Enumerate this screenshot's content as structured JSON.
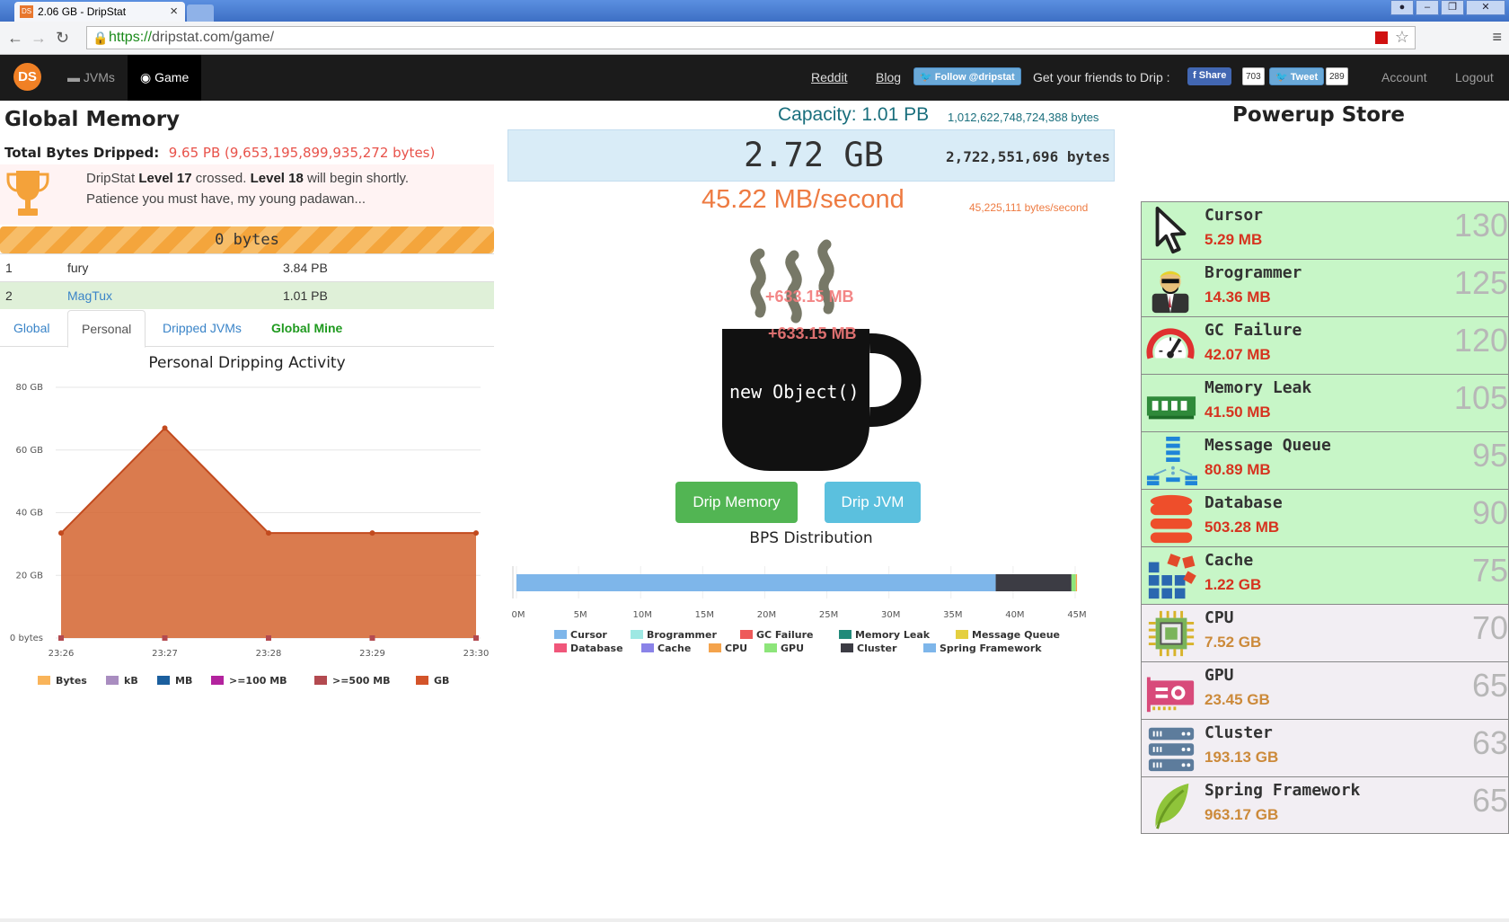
{
  "browser": {
    "tab_title": "2.06 GB - DripStat",
    "tab_favicon": "DS",
    "url_scheme": "https://",
    "url_rest": "dripstat.com/game/"
  },
  "nav": {
    "logo": "DS",
    "jvms": "JVMs",
    "game": "Game",
    "reddit": "Reddit",
    "blog": "Blog",
    "twitter_follow": "Follow @dripstat",
    "friends_text": "Get your friends to Drip :",
    "fb_share": "Share",
    "fb_count": "703",
    "tweet": "Tweet",
    "tweet_count": "289",
    "account": "Account",
    "logout": "Logout"
  },
  "global_memory": {
    "title": "Global Memory",
    "total_label": "Total Bytes Dripped:",
    "total_value": "9.65 PB (9,653,195,899,935,272 bytes)",
    "level_line1_a": "DripStat ",
    "level_line1_b": "Level 17",
    "level_line1_c": " crossed. ",
    "level_line1_d": "Level 18",
    "level_line1_e": " will begin shortly.",
    "level_line2": "Patience you must have, my young padawan...",
    "progress_label": "0 bytes",
    "progress_fraction": 0
  },
  "leaderboard": [
    {
      "rank": "1",
      "name": "fury",
      "value": "3.84 PB"
    },
    {
      "rank": "2",
      "name": "MagTux",
      "value": "1.01 PB"
    }
  ],
  "tabs": {
    "global": "Global",
    "personal": "Personal",
    "dripped": "Dripped JVMs",
    "mine": "Global Mine"
  },
  "activity_chart": {
    "title": "Personal Dripping Activity",
    "legend": [
      {
        "label": "Bytes",
        "color": "#f9b45a"
      },
      {
        "label": "kB",
        "color": "#a98dc0"
      },
      {
        "label": "MB",
        "color": "#1b5f9e"
      },
      {
        "label": ">=100 MB",
        "color": "#b3239e"
      },
      {
        "label": ">=500 MB",
        "color": "#b34a50"
      },
      {
        "label": "GB",
        "color": "#d3542a"
      }
    ]
  },
  "chart_data": [
    {
      "type": "area",
      "title": "Personal Dripping Activity",
      "x": [
        "23:26",
        "23:27",
        "23:28",
        "23:29",
        "23:30"
      ],
      "series": [
        {
          "name": "GB",
          "values": [
            33.5,
            67,
            33.5,
            33.5,
            33.5
          ]
        }
      ],
      "y_tick_labels": [
        "0 bytes",
        "20 GB",
        "40 GB",
        "60 GB",
        "80 GB"
      ],
      "y_ticks": [
        0,
        20,
        40,
        60,
        80
      ],
      "ylim": [
        0,
        80
      ],
      "grid": true,
      "legend_position": "bottom"
    },
    {
      "type": "bar",
      "title": "BPS Distribution",
      "orientation": "horizontal-stacked",
      "x_tick_labels": [
        "0M",
        "5M",
        "10M",
        "15M",
        "20M",
        "25M",
        "30M",
        "35M",
        "40M",
        "45M"
      ],
      "x_ticks": [
        0,
        5,
        10,
        15,
        20,
        25,
        30,
        35,
        40,
        45
      ],
      "xlim": [
        0,
        45
      ],
      "segments": [
        {
          "name": "Spring Framework",
          "value": 38.6,
          "color": "#7eb6ea"
        },
        {
          "name": "Cluster",
          "value": 6.1,
          "color": "#3c3c44"
        },
        {
          "name": "GPU",
          "value": 0.35,
          "color": "#8de57a"
        },
        {
          "name": "CPU",
          "value": 0.1,
          "color": "#f4a34c"
        }
      ],
      "legend": [
        {
          "label": "Cursor",
          "color": "#7eb6ea"
        },
        {
          "label": "Brogrammer",
          "color": "#9ee8e3"
        },
        {
          "label": "GC Failure",
          "color": "#ee5a5a"
        },
        {
          "label": "Memory Leak",
          "color": "#218a7a"
        },
        {
          "label": "Message Queue",
          "color": "#e4cf3f"
        },
        {
          "label": "Database",
          "color": "#f0567a"
        },
        {
          "label": "Cache",
          "color": "#8a83e8"
        },
        {
          "label": "CPU",
          "color": "#f4a34c"
        },
        {
          "label": "GPU",
          "color": "#8de57a"
        },
        {
          "label": "Cluster",
          "color": "#3c3c44"
        },
        {
          "label": "Spring Framework",
          "color": "#7eb6ea"
        }
      ],
      "legend_position": "bottom"
    }
  ],
  "memory": {
    "capacity": "Capacity: 1.01 PB",
    "capacity_bytes": "1,012,622,748,724,388 bytes",
    "current_gb": "2.72 GB",
    "current_bytes": "2,722,551,696 bytes",
    "rate": "45.22 MB/second",
    "rate_bytes": "45,225,111 bytes/second",
    "cup_text": "new Object()",
    "float_1": "+633.15 MB",
    "float_2": "+633.15 MB",
    "drip_memory": "Drip Memory",
    "drip_jvm": "Drip JVM",
    "bps_title": "BPS Distribution"
  },
  "store": {
    "title": "Powerup Store",
    "items": [
      {
        "name": "Cursor",
        "price": "5.29 MB",
        "owned": "130",
        "affordable": true,
        "icon": "cursor-icon"
      },
      {
        "name": "Brogrammer",
        "price": "14.36 MB",
        "owned": "125",
        "affordable": true,
        "icon": "brogrammer-icon"
      },
      {
        "name": "GC Failure",
        "price": "42.07 MB",
        "owned": "120",
        "affordable": true,
        "icon": "gauge-icon"
      },
      {
        "name": "Memory Leak",
        "price": "41.50 MB",
        "owned": "105",
        "affordable": true,
        "icon": "ram-icon"
      },
      {
        "name": "Message Queue",
        "price": "80.89 MB",
        "owned": "95",
        "affordable": true,
        "icon": "queue-icon"
      },
      {
        "name": "Database",
        "price": "503.28 MB",
        "owned": "90",
        "affordable": true,
        "icon": "database-icon"
      },
      {
        "name": "Cache",
        "price": "1.22 GB",
        "owned": "75",
        "affordable": true,
        "icon": "cache-icon"
      },
      {
        "name": "CPU",
        "price": "7.52 GB",
        "owned": "70",
        "affordable": false,
        "icon": "cpu-icon"
      },
      {
        "name": "GPU",
        "price": "23.45 GB",
        "owned": "65",
        "affordable": false,
        "icon": "gpu-icon"
      },
      {
        "name": "Cluster",
        "price": "193.13 GB",
        "owned": "63",
        "affordable": false,
        "icon": "server-icon"
      },
      {
        "name": "Spring Framework",
        "price": "963.17 GB",
        "owned": "65",
        "affordable": false,
        "icon": "leaf-icon"
      }
    ]
  }
}
